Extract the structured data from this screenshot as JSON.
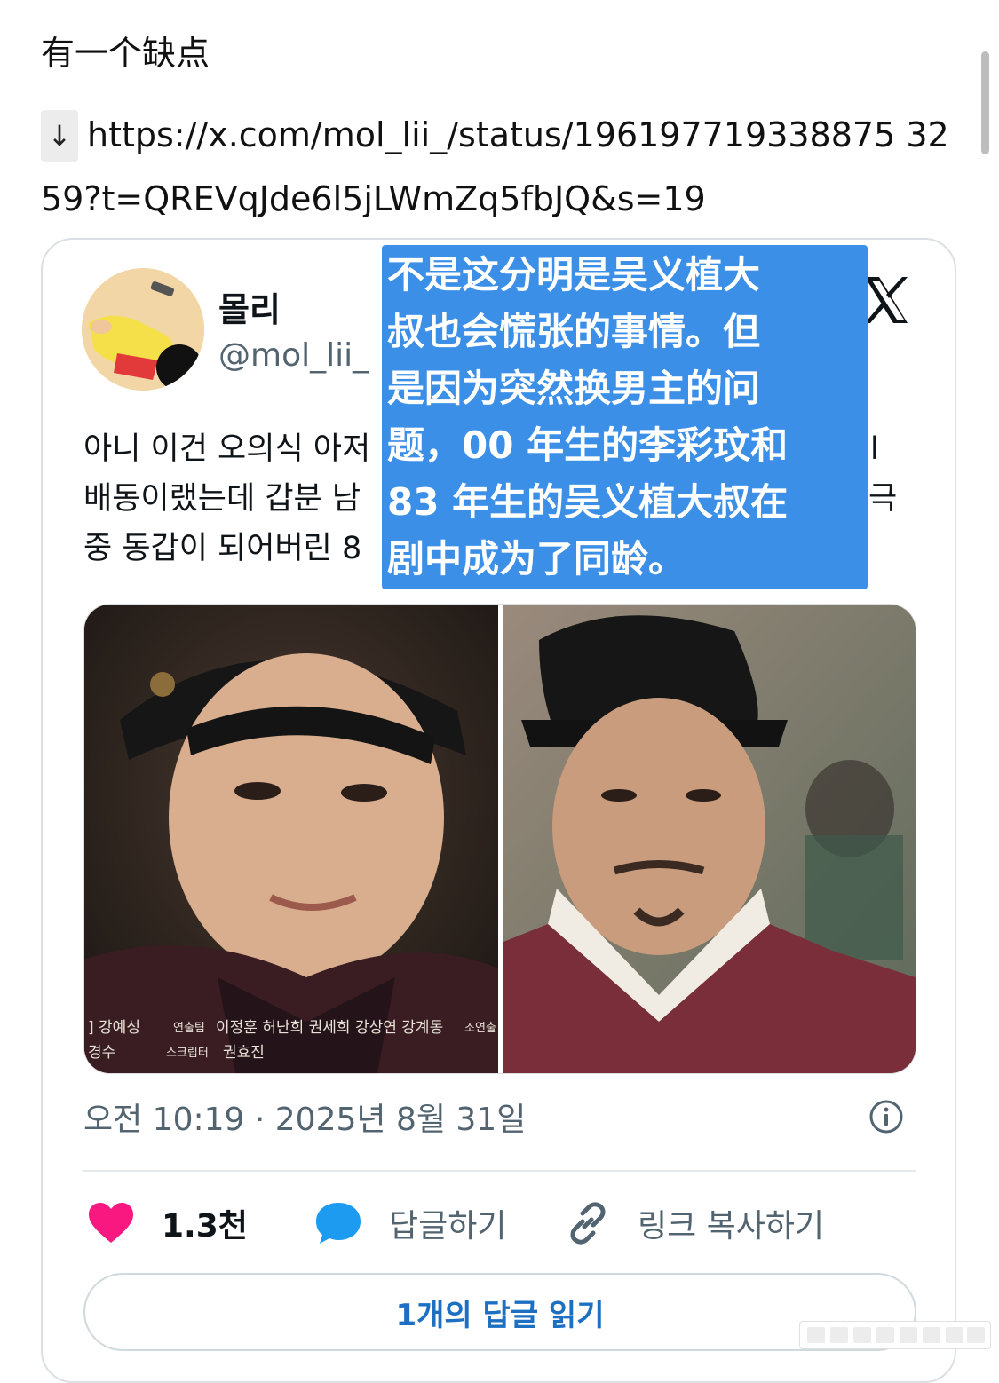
{
  "post": {
    "line1": "有一个缺点",
    "arrow": "↓",
    "link_part1": "https://x.com/mol_lii_/status/196197719338875 32",
    "link_part2": "59?t=QREVqJde6l5jLWmZq5fbJQ&s=19"
  },
  "tweet": {
    "author_name": "몰리",
    "author_handle": "@mol_lii_",
    "text_lines": [
      "아니 이건 오의식 아저",
      "배동이랬는데 갑분 남",
      "중 동갑이 되어버린 8"
    ],
    "text_edges": [
      "l",
      "극"
    ],
    "photo_left_caption": {
      "a": "] 강예성",
      "b": "연출팀",
      "c": "이정훈 허난희 권세희 강상연 강계동",
      "d": "조연출",
      "e": "경수",
      "f": "스크립터",
      "g": "권효진"
    },
    "timestamp": "오전 10:19 · 2025년 8월 31일",
    "like_count": "1.3천",
    "reply_label": "답글하기",
    "copy_link_label": "링크 복사하기",
    "read_replies_label": "1개의 답글 읽기"
  },
  "overlay": {
    "lines": [
      "不是这分明是吴义植大",
      "叔也会慌张的事情。但",
      "是因为突然换男主的问",
      "题，00 年生的李彩玟和",
      "83 年生的吴义植大叔在",
      "剧中成为了同龄。"
    ]
  },
  "colors": {
    "like": "#f91880",
    "reply": "#1d9bf0",
    "overlay_bg": "#3b8fe6",
    "link_blue": "#1d6fc2"
  }
}
